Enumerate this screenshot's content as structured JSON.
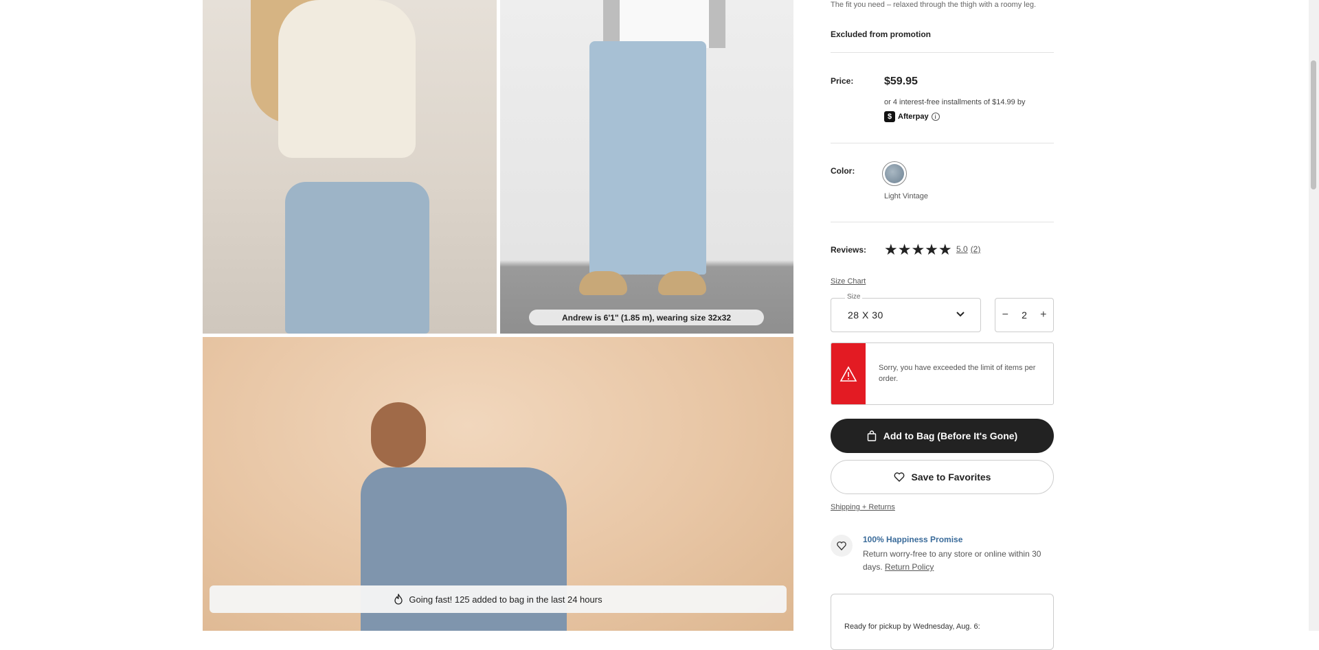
{
  "gallery": {
    "caption": "Andrew is 6'1\" (1.85 m), wearing size 32x32",
    "going_fast": "Going fast! 125 added to bag in the last 24 hours"
  },
  "product": {
    "description": "The fit you need – relaxed through the thigh with a roomy leg.",
    "excluded": "Excluded from promotion",
    "price_label": "Price:",
    "price": "$59.95",
    "installments": "or 4 interest-free installments of $14.99 by",
    "afterpay_badge": "$",
    "afterpay_label": "Afterpay",
    "afterpay_info": "i",
    "color_label": "Color:",
    "color_name": "Light Vintage",
    "reviews_label": "Reviews:",
    "stars": "★★★★★",
    "rating": 5.0,
    "rating_text": "5.0",
    "review_count": "(2)",
    "size_chart_link": "Size Chart",
    "size_legend": "Size",
    "size_value": "28 X 30",
    "quantity": "2",
    "qty_minus": "−",
    "qty_plus": "+",
    "alert_text": "Sorry, you have exceeded the limit of items per order.",
    "add_to_bag": "Add to Bag (Before It's Gone)",
    "save_favorites": "Save to Favorites",
    "shipping_link": "Shipping + Returns",
    "promise_title": "100% Happiness Promise",
    "promise_text": "Return worry-free to any store or online within 30 days.",
    "return_policy_link": "Return Policy",
    "pickup_text": "Ready for pickup by Wednesday, Aug. 6:"
  },
  "colors": {
    "alert_red": "#e31b23",
    "primary_button": "#222222",
    "promise_blue": "#3a6b9a"
  }
}
